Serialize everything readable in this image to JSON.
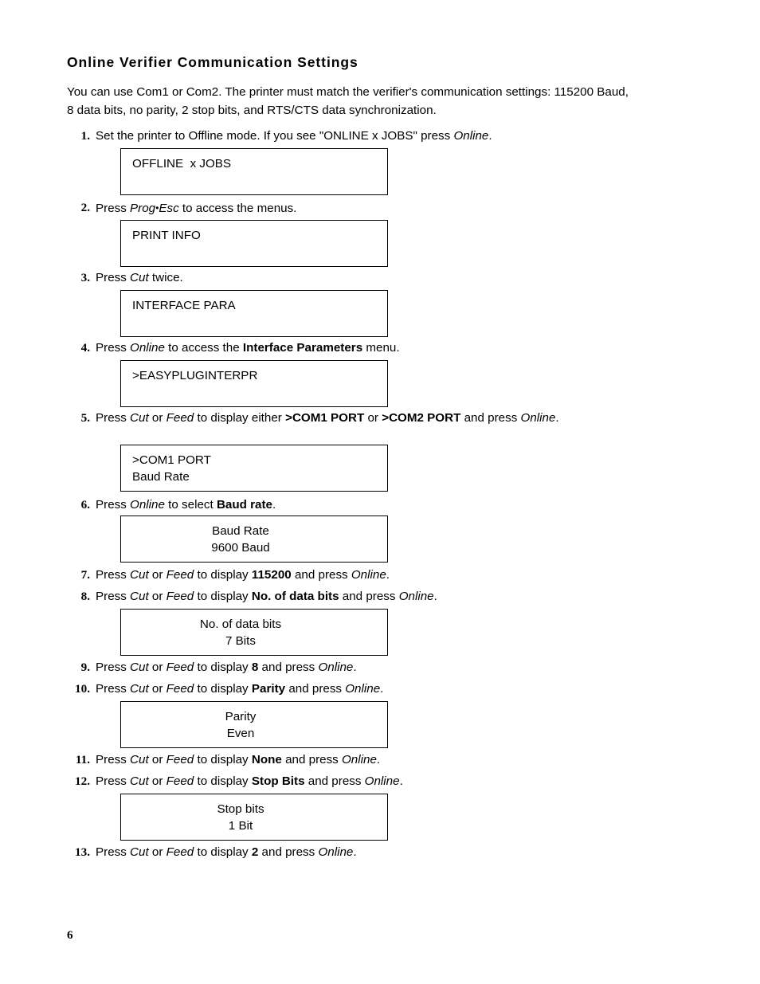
{
  "document": {
    "heading": "Online Verifier Communication Settings",
    "intro": "You can use Com1 or Com2.  The printer must match the verifier's communication settings:  115200 Baud, 8 data bits, no parity, 2 stop bits, and RTS/CTS data synchronization.",
    "page_number": "6"
  },
  "steps": [
    {
      "number": "1.",
      "segments": [
        {
          "text": "Set the printer to Offline mode.  If you see \"ONLINE  x JOBS\" press ",
          "style": "normal"
        },
        {
          "text": "Online",
          "style": "italic"
        },
        {
          "text": ".",
          "style": "normal"
        }
      ]
    },
    {
      "number": "2.",
      "segments": [
        {
          "text": "Press ",
          "style": "normal"
        },
        {
          "text": "Prog",
          "style": "italic"
        },
        {
          "text": "•",
          "style": "bullet"
        },
        {
          "text": "Esc",
          "style": "italic"
        },
        {
          "text": " to access the menus.",
          "style": "normal"
        }
      ]
    },
    {
      "number": "3.",
      "segments": [
        {
          "text": "Press ",
          "style": "normal"
        },
        {
          "text": "Cut",
          "style": "italic"
        },
        {
          "text": " twice.",
          "style": "normal"
        }
      ]
    },
    {
      "number": "4.",
      "segments": [
        {
          "text": "Press ",
          "style": "normal"
        },
        {
          "text": "Online",
          "style": "italic"
        },
        {
          "text": " to access the ",
          "style": "normal"
        },
        {
          "text": "Interface Parameters",
          "style": "bold"
        },
        {
          "text": " menu.",
          "style": "normal"
        }
      ]
    },
    {
      "number": "5.",
      "segments": [
        {
          "text": "Press ",
          "style": "normal"
        },
        {
          "text": "Cut",
          "style": "italic"
        },
        {
          "text": " or ",
          "style": "normal"
        },
        {
          "text": "Feed",
          "style": "italic"
        },
        {
          "text": " to display either ",
          "style": "normal"
        },
        {
          "text": ">COM1 PORT",
          "style": "bold"
        },
        {
          "text": " or ",
          "style": "normal"
        },
        {
          "text": ">COM2 PORT",
          "style": "bold"
        },
        {
          "text": " and press ",
          "style": "normal"
        },
        {
          "text": "Online",
          "style": "italic"
        },
        {
          "text": ".",
          "style": "normal"
        }
      ]
    },
    {
      "number": "6.",
      "segments": [
        {
          "text": "Press ",
          "style": "normal"
        },
        {
          "text": "Online",
          "style": "italic"
        },
        {
          "text": " to select ",
          "style": "normal"
        },
        {
          "text": "Baud rate",
          "style": "bold"
        },
        {
          "text": ".",
          "style": "normal"
        }
      ]
    },
    {
      "number": "7.",
      "segments": [
        {
          "text": "Press ",
          "style": "normal"
        },
        {
          "text": "Cut",
          "style": "italic"
        },
        {
          "text": " or ",
          "style": "normal"
        },
        {
          "text": "Feed",
          "style": "italic"
        },
        {
          "text": " to display ",
          "style": "normal"
        },
        {
          "text": "115200",
          "style": "bold"
        },
        {
          "text": " and press ",
          "style": "normal"
        },
        {
          "text": "Online",
          "style": "italic"
        },
        {
          "text": ".",
          "style": "normal"
        }
      ]
    },
    {
      "number": "8.",
      "segments": [
        {
          "text": "Press ",
          "style": "normal"
        },
        {
          "text": "Cut",
          "style": "italic"
        },
        {
          "text": " or ",
          "style": "normal"
        },
        {
          "text": "Feed",
          "style": "italic"
        },
        {
          "text": " to display ",
          "style": "normal"
        },
        {
          "text": "No. of data bits",
          "style": "bold"
        },
        {
          "text": " and press ",
          "style": "normal"
        },
        {
          "text": "Online",
          "style": "italic"
        },
        {
          "text": ".",
          "style": "normal"
        }
      ]
    },
    {
      "number": "9.",
      "segments": [
        {
          "text": "Press ",
          "style": "normal"
        },
        {
          "text": "Cut",
          "style": "italic"
        },
        {
          "text": " or ",
          "style": "normal"
        },
        {
          "text": "Feed",
          "style": "italic"
        },
        {
          "text": " to display ",
          "style": "normal"
        },
        {
          "text": "8",
          "style": "bold"
        },
        {
          "text": " and press ",
          "style": "normal"
        },
        {
          "text": "Online",
          "style": "italic"
        },
        {
          "text": ".",
          "style": "normal"
        }
      ]
    },
    {
      "number": "10.",
      "segments": [
        {
          "text": "Press ",
          "style": "normal"
        },
        {
          "text": "Cut",
          "style": "italic"
        },
        {
          "text": " or ",
          "style": "normal"
        },
        {
          "text": "Feed",
          "style": "italic"
        },
        {
          "text": " to display ",
          "style": "normal"
        },
        {
          "text": "Parity",
          "style": "bold"
        },
        {
          "text": " and press ",
          "style": "normal"
        },
        {
          "text": "Online",
          "style": "italic"
        },
        {
          "text": ".",
          "style": "normal"
        }
      ]
    },
    {
      "number": "11.",
      "segments": [
        {
          "text": "Press ",
          "style": "normal"
        },
        {
          "text": "Cut",
          "style": "italic"
        },
        {
          "text": " or ",
          "style": "normal"
        },
        {
          "text": "Feed",
          "style": "italic"
        },
        {
          "text": " to display ",
          "style": "normal"
        },
        {
          "text": "None",
          "style": "bold"
        },
        {
          "text": " and press ",
          "style": "normal"
        },
        {
          "text": "Online",
          "style": "italic"
        },
        {
          "text": ".",
          "style": "normal"
        }
      ]
    },
    {
      "number": "12.",
      "segments": [
        {
          "text": "Press ",
          "style": "normal"
        },
        {
          "text": "Cut",
          "style": "italic"
        },
        {
          "text": " or ",
          "style": "normal"
        },
        {
          "text": "Feed",
          "style": "italic"
        },
        {
          "text": " to display ",
          "style": "normal"
        },
        {
          "text": "Stop Bits",
          "style": "bold"
        },
        {
          "text": " and press ",
          "style": "normal"
        },
        {
          "text": "Online",
          "style": "italic"
        },
        {
          "text": ".",
          "style": "normal"
        }
      ]
    },
    {
      "number": "13.",
      "segments": [
        {
          "text": "Press ",
          "style": "normal"
        },
        {
          "text": "Cut",
          "style": "italic"
        },
        {
          "text": " or ",
          "style": "normal"
        },
        {
          "text": "Feed",
          "style": "italic"
        },
        {
          "text": " to display ",
          "style": "normal"
        },
        {
          "text": "2",
          "style": "bold"
        },
        {
          "text": " and press ",
          "style": "normal"
        },
        {
          "text": "Online",
          "style": "italic"
        },
        {
          "text": ".",
          "style": "normal"
        }
      ]
    }
  ],
  "lcd_displays": [
    {
      "id": "offline-jobs",
      "align": "left",
      "lines": [
        "OFFLINE  x JOBS"
      ]
    },
    {
      "id": "print-info",
      "align": "left",
      "lines": [
        "PRINT INFO"
      ]
    },
    {
      "id": "interface-para",
      "align": "left",
      "lines": [
        "INTERFACE PARA"
      ]
    },
    {
      "id": "easyplug",
      "align": "left",
      "lines": [
        ">EASYPLUGINTERPR"
      ]
    },
    {
      "id": "com1-port",
      "align": "left",
      "lines": [
        ">COM1 PORT",
        "Baud Rate"
      ]
    },
    {
      "id": "baud-rate",
      "align": "center",
      "lines": [
        "Baud Rate",
        "9600 Baud"
      ]
    },
    {
      "id": "data-bits",
      "align": "center",
      "lines": [
        "No. of data bits",
        "7 Bits"
      ]
    },
    {
      "id": "parity",
      "align": "center",
      "lines": [
        "Parity",
        "Even"
      ]
    },
    {
      "id": "stop-bits",
      "align": "center",
      "lines": [
        "Stop bits",
        "1 Bit"
      ]
    }
  ],
  "layout": {
    "step_tops": [
      160,
      250,
      338,
      426,
      514,
      623,
      711,
      738,
      827,
      854,
      943,
      970,
      1059
    ],
    "lcd_tops": [
      186,
      276,
      364,
      452,
      558,
      647,
      764,
      880,
      996
    ]
  }
}
